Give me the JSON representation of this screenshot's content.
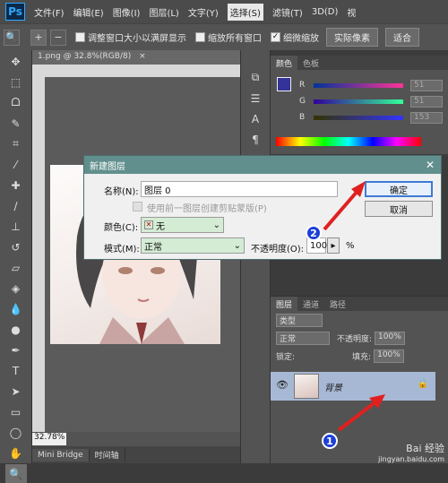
{
  "menubar": {
    "logo": "Ps",
    "items": [
      "文件(F)",
      "编辑(E)",
      "图像(I)",
      "图层(L)",
      "文字(Y)",
      "选择(S)",
      "滤镜(T)",
      "3D(D)",
      "视"
    ],
    "active_index": 5
  },
  "options": {
    "resize_windows": "调整窗口大小以满屏显示",
    "zoom_all": "缩放所有窗口",
    "scrubby_zoom": "细微缩放",
    "actual_pixels": "实际像素",
    "fit_screen": "适合"
  },
  "document": {
    "tab_title": "1.png @ 32.8%(RGB/8)",
    "close": "×",
    "zoom": "32.78%"
  },
  "bottom_tabs": [
    "Mini Bridge",
    "时间轴"
  ],
  "color_panel": {
    "tabs": [
      "颜色",
      "色板"
    ],
    "channels": [
      {
        "label": "R",
        "value": "51"
      },
      {
        "label": "G",
        "value": "51"
      },
      {
        "label": "B",
        "value": "153"
      }
    ],
    "foreground_color": "#333399"
  },
  "layers_panel": {
    "tabs": [
      "图层",
      "通道",
      "路径"
    ],
    "filter": "类型",
    "blend_mode": "正常",
    "opacity_label": "不透明度:",
    "opacity_value": "100%",
    "lock_label": "锁定:",
    "fill_label": "填充:",
    "fill_value": "100%",
    "layer_name": "背景"
  },
  "dialog": {
    "title": "新建图层",
    "close": "✕",
    "name_label": "名称(N):",
    "name_value": "图层 0",
    "clip_label": "使用前一图层创建剪贴蒙版(P)",
    "color_label": "颜色(C):",
    "color_value": "无",
    "mode_label": "模式(M):",
    "mode_value": "正常",
    "opacity_label": "不透明度(O):",
    "opacity_value": "100",
    "percent": "%",
    "ok": "确定",
    "cancel": "取消"
  },
  "annotations": {
    "badge1": "1",
    "badge2": "2",
    "accent": "#e02020"
  },
  "watermark": {
    "line1": "Bai 经验",
    "line2": "jingyan.baidu.com"
  }
}
